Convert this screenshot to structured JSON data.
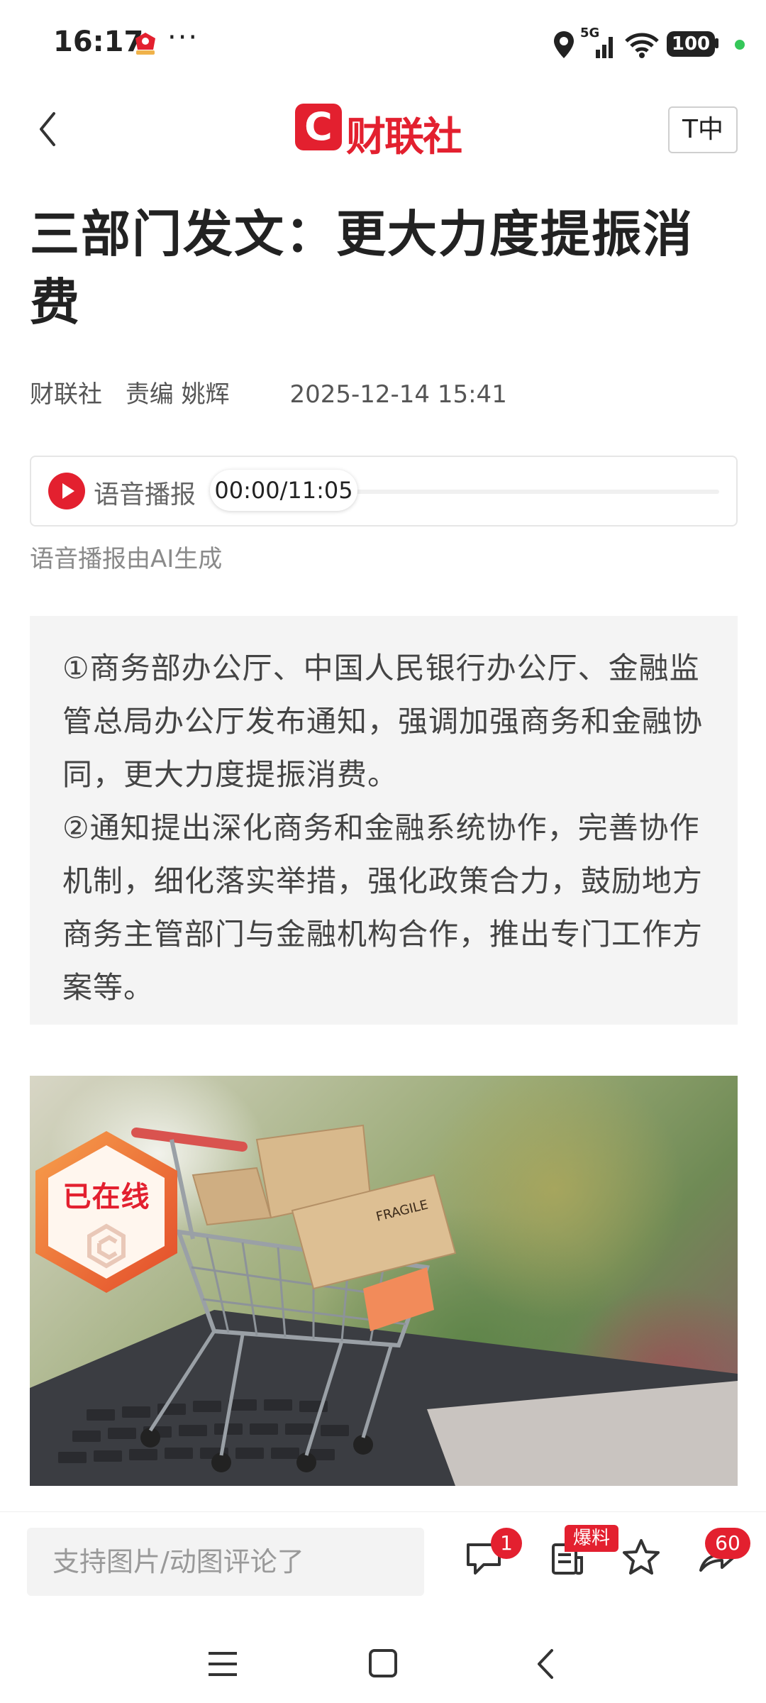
{
  "status_bar": {
    "time": "16:17",
    "network": "5G",
    "battery": "100",
    "more": "···",
    "icons": [
      "app-notification-icon",
      "location-icon",
      "signal-icon",
      "wifi-icon",
      "battery-icon"
    ]
  },
  "header": {
    "brand_name": "财联社",
    "brand_logo_letter": "C",
    "font_size_label": "T中",
    "brand_color": "#e3202f"
  },
  "article": {
    "title": "三部门发文：更大力度提振消费",
    "source": "财联社",
    "editor": "责编 姚辉",
    "datetime": "2025-12-14 15:41",
    "audio": {
      "label": "语音播报",
      "time": "00:00/11:05",
      "progress": 0,
      "note": "语音播报由AI生成"
    },
    "summary": [
      "①商务部办公厅、中国人民银行办公厅、金融监管总局办公厅发布通知，强调加强商务和金融协同，更大力度提振消费。",
      "②通知提出深化商务和金融系统协作，完善协作机制，细化落实举措，强化政策合力，鼓励地方商务主管部门与金融机构合作，推出专门工作方案等。"
    ],
    "online_badge": "已在线",
    "image_alt_label": "FRAGILE"
  },
  "bottom_bar": {
    "comment_placeholder": "支持图片/动图评论了",
    "comment_count": "1",
    "report_label": "爆料",
    "share_count": "60"
  }
}
